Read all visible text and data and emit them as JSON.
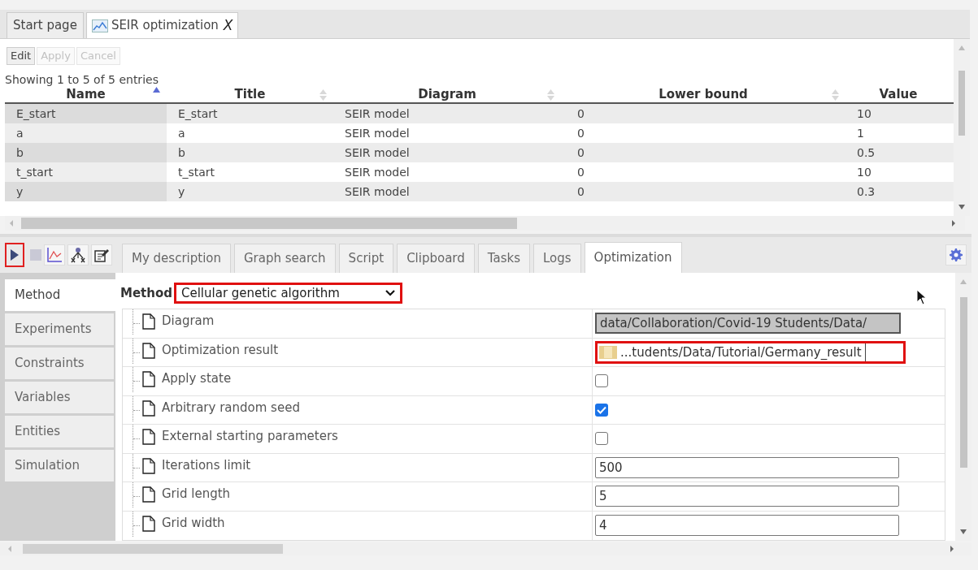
{
  "document_tabs": [
    {
      "label": "Start page",
      "selected": false
    },
    {
      "label": "SEIR optimization",
      "selected": true,
      "close": "X"
    }
  ],
  "edit_buttons": [
    {
      "label": "Edit",
      "disabled": false
    },
    {
      "label": "Apply",
      "disabled": true
    },
    {
      "label": "Cancel",
      "disabled": true
    }
  ],
  "table": {
    "info": "Showing 1 to 5 of 5 entries",
    "columns": [
      {
        "label": "Name",
        "sortable": true,
        "sorted": true
      },
      {
        "label": "Title",
        "sortable": true,
        "sorted": false
      },
      {
        "label": "Diagram",
        "sortable": true,
        "sorted": false
      },
      {
        "label": "Lower bound",
        "sortable": true,
        "sorted": false
      },
      {
        "label": "Value"
      }
    ],
    "rows": [
      [
        "E_start",
        "E_start",
        "SEIR model",
        "0",
        "10"
      ],
      [
        "a",
        "a",
        "SEIR model",
        "0",
        "1"
      ],
      [
        "b",
        "b",
        "SEIR model",
        "0",
        "0.5"
      ],
      [
        "t_start",
        "t_start",
        "SEIR model",
        "0",
        "10"
      ],
      [
        "y",
        "y",
        "SEIR model",
        "0",
        "0.3"
      ]
    ]
  },
  "toolbar": {
    "run_highlighted": true
  },
  "panel_tabs": [
    {
      "label": "My description",
      "selected": false
    },
    {
      "label": "Graph search",
      "selected": false
    },
    {
      "label": "Script",
      "selected": false
    },
    {
      "label": "Clipboard",
      "selected": false
    },
    {
      "label": "Tasks",
      "selected": false
    },
    {
      "label": "Logs",
      "selected": false
    },
    {
      "label": "Optimization",
      "selected": true
    }
  ],
  "side_tabs": [
    {
      "label": "Method",
      "selected": true
    },
    {
      "label": "Experiments",
      "selected": false
    },
    {
      "label": "Constraints",
      "selected": false
    },
    {
      "label": "Variables",
      "selected": false
    },
    {
      "label": "Entities",
      "selected": false
    },
    {
      "label": "Simulation",
      "selected": false
    }
  ],
  "method": {
    "label": "Method",
    "value": "Cellular genetic algorithm",
    "highlighted": true
  },
  "properties": [
    {
      "label": "Diagram",
      "kind": "readonly",
      "value": "data/Collaboration/Covid-19 Students/Data/"
    },
    {
      "label": "Optimization result",
      "kind": "file",
      "value": "...tudents/Data/Tutorial/Germany_result",
      "highlighted": true
    },
    {
      "label": "Apply state",
      "kind": "checkbox",
      "checked": false
    },
    {
      "label": "Arbitrary random seed",
      "kind": "checkbox",
      "checked": true
    },
    {
      "label": "External starting parameters",
      "kind": "checkbox",
      "checked": false
    },
    {
      "label": "Iterations limit",
      "kind": "text",
      "value": "500"
    },
    {
      "label": "Grid length",
      "kind": "text",
      "value": "5"
    },
    {
      "label": "Grid width",
      "kind": "text",
      "value": "4"
    }
  ]
}
